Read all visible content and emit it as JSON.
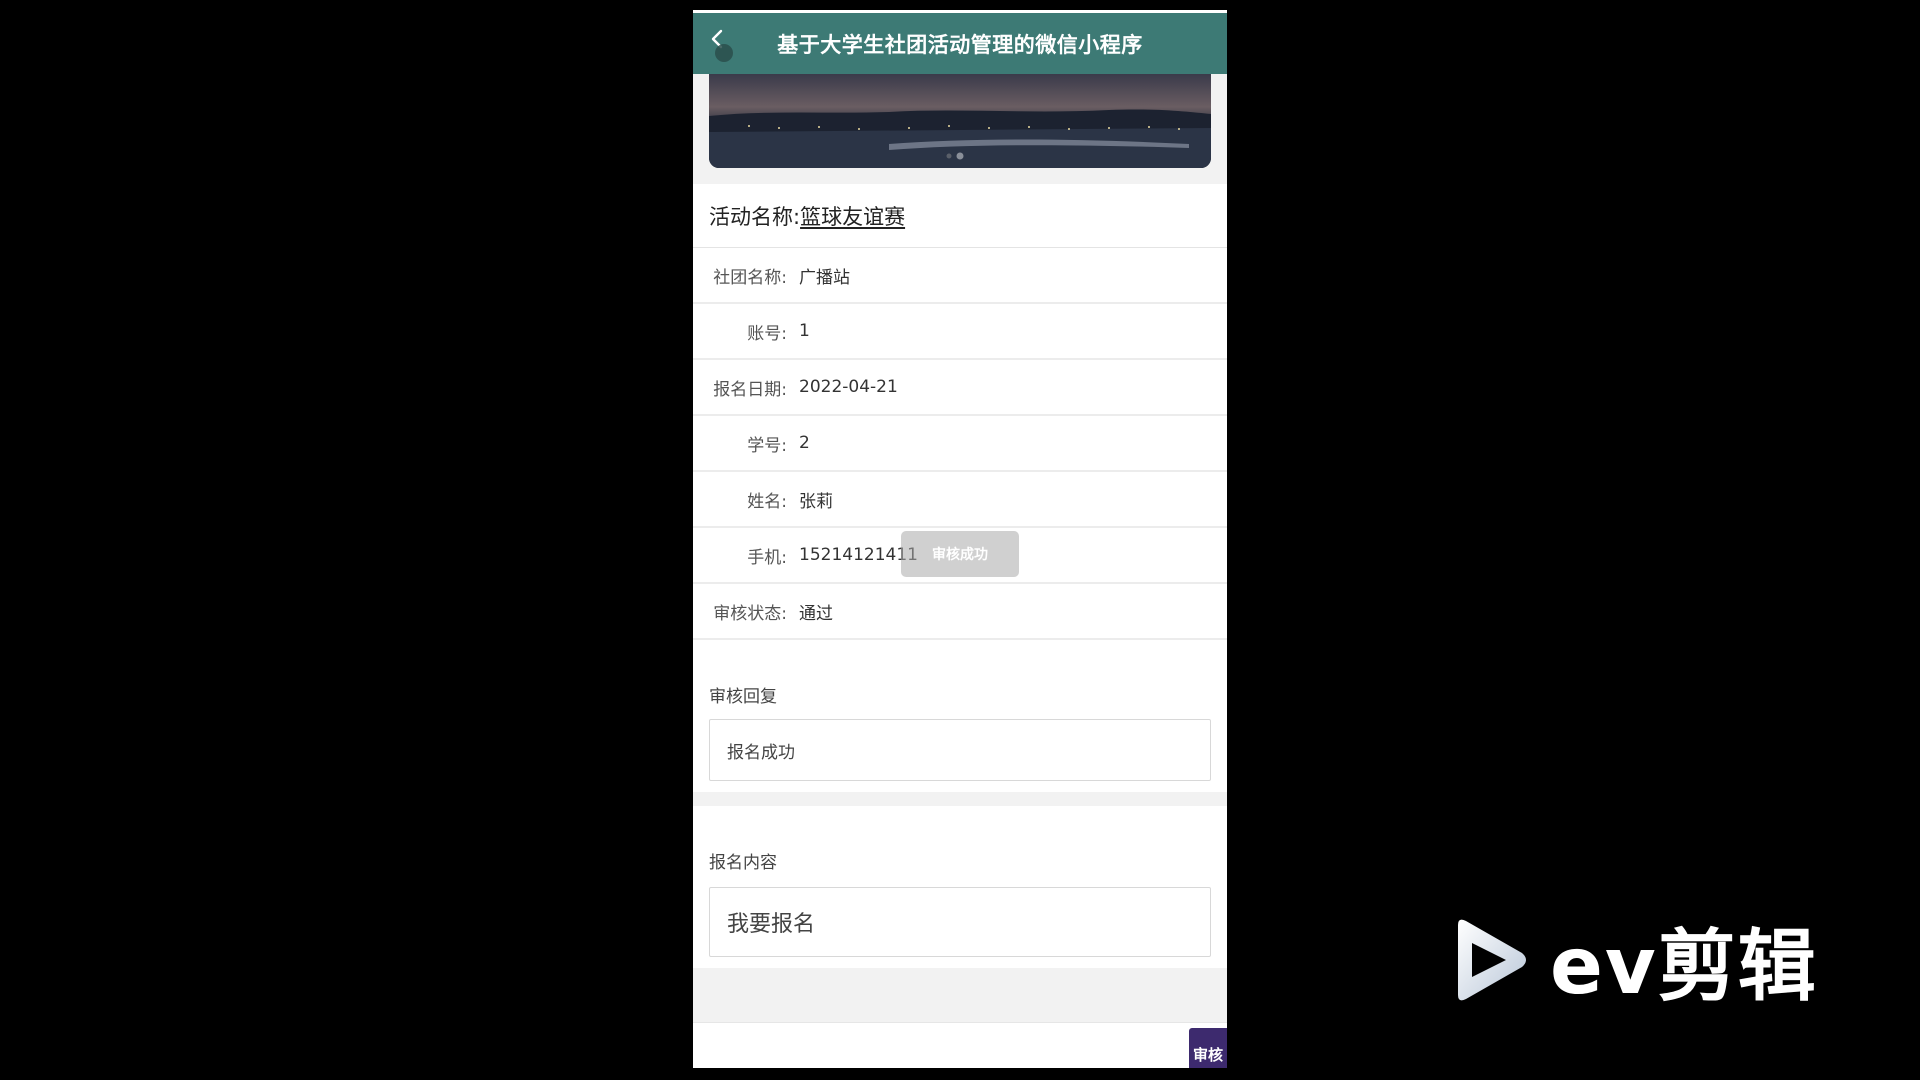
{
  "header": {
    "title": "基于大学生社团活动管理的微信小程序",
    "bg_color": "#3d7a75"
  },
  "activity": {
    "label": "活动名称:",
    "value": "篮球友谊赛"
  },
  "details": [
    {
      "label": "社团名称:",
      "value": "广播站"
    },
    {
      "label": "账号:",
      "value": "1"
    },
    {
      "label": "报名日期:",
      "value": "2022-04-21"
    },
    {
      "label": "学号:",
      "value": "2"
    },
    {
      "label": "姓名:",
      "value": "张莉"
    },
    {
      "label": "手机:",
      "value": "15214121411"
    },
    {
      "label": "审核状态:",
      "value": "通过"
    }
  ],
  "toast": {
    "text": "审核成功"
  },
  "reply": {
    "label": "审核回复",
    "value": "报名成功"
  },
  "content": {
    "label": "报名内容",
    "value": "我要报名"
  },
  "actions": {
    "audit_label": "审核",
    "audit_color": "#3d2a6e"
  },
  "watermark": {
    "text": "ev剪辑"
  }
}
